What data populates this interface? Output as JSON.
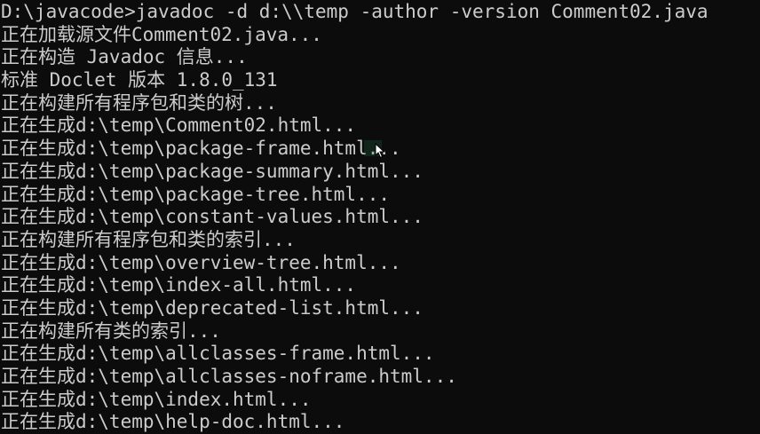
{
  "console": {
    "lines": [
      "D:\\javacode>javadoc -d d:\\\\temp -author -version Comment02.java",
      "正在加载源文件Comment02.java...",
      "正在构造 Javadoc 信息...",
      "标准 Doclet 版本 1.8.0_131",
      "正在构建所有程序包和类的树...",
      "正在生成d:\\temp\\Comment02.html...",
      "正在生成d:\\temp\\package-frame.html...",
      "正在生成d:\\temp\\package-summary.html...",
      "正在生成d:\\temp\\package-tree.html...",
      "正在生成d:\\temp\\constant-values.html...",
      "正在构建所有程序包和类的索引...",
      "正在生成d:\\temp\\overview-tree.html...",
      "正在生成d:\\temp\\index-all.html...",
      "正在生成d:\\temp\\deprecated-list.html...",
      "正在构建所有类的索引...",
      "正在生成d:\\temp\\allclasses-frame.html...",
      "正在生成d:\\temp\\allclasses-noframe.html...",
      "正在生成d:\\temp\\index.html...",
      "正在生成d:\\temp\\help-doc.html..."
    ]
  },
  "colors": {
    "background": "#0c0c0c",
    "text": "#cccccc",
    "cursor_tint": "#1e6e46"
  },
  "icons": {
    "mouse_cursor": "mouse-pointer-icon"
  }
}
